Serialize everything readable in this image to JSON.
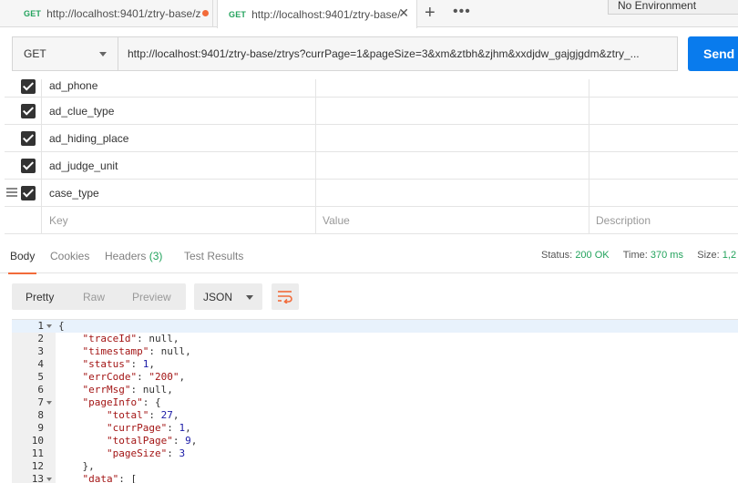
{
  "tabs": [
    {
      "method": "GET",
      "title": "http://localhost:9401/ztry-base/z",
      "unsaved": true
    },
    {
      "method": "GET",
      "title": "http://localhost:9401/ztry-base/",
      "close": "✕"
    }
  ],
  "tabbar": {
    "add": "+",
    "more": "•••",
    "environment": "No Environment"
  },
  "request": {
    "method": "GET",
    "url": "http://localhost:9401/ztry-base/ztrys?currPage=1&pageSize=3&xm&ztbh&zjhm&xxdjdw_gajgjgdm&ztry_...",
    "send_label": "Send"
  },
  "params": {
    "rows": [
      {
        "key": "ad_phone",
        "checked": true
      },
      {
        "key": "ad_clue_type",
        "checked": true
      },
      {
        "key": "ad_hiding_place",
        "checked": true
      },
      {
        "key": "ad_judge_unit",
        "checked": true
      },
      {
        "key": "case_type",
        "checked": true
      }
    ],
    "placeholder": {
      "key": "Key",
      "value": "Value",
      "description": "Description"
    }
  },
  "response": {
    "tabs": {
      "body": "Body",
      "cookies": "Cookies",
      "headers": "Headers",
      "headers_count": "(3)",
      "test_results": "Test Results"
    },
    "status_label": "Status:",
    "status_value": "200 OK",
    "time_label": "Time:",
    "time_value": "370 ms",
    "size_label": "Size:",
    "size_value": "1,2",
    "views": {
      "pretty": "Pretty",
      "raw": "Raw",
      "preview": "Preview"
    },
    "format": "JSON",
    "code_lines": [
      {
        "n": "1",
        "fold": true,
        "html": "{"
      },
      {
        "n": "2",
        "html": "    <span class=\"k\">\"traceId\"</span>: null,"
      },
      {
        "n": "3",
        "html": "    <span class=\"k\">\"timestamp\"</span>: null,"
      },
      {
        "n": "4",
        "html": "    <span class=\"k\">\"status\"</span>: <span class=\"n\">1</span>,"
      },
      {
        "n": "5",
        "html": "    <span class=\"k\">\"errCode\"</span>: <span class=\"s\">\"200\"</span>,"
      },
      {
        "n": "6",
        "html": "    <span class=\"k\">\"errMsg\"</span>: null,"
      },
      {
        "n": "7",
        "fold": true,
        "html": "    <span class=\"k\">\"pageInfo\"</span>: {"
      },
      {
        "n": "8",
        "html": "        <span class=\"k\">\"total\"</span>: <span class=\"n\">27</span>,"
      },
      {
        "n": "9",
        "html": "        <span class=\"k\">\"currPage\"</span>: <span class=\"n\">1</span>,"
      },
      {
        "n": "10",
        "html": "        <span class=\"k\">\"totalPage\"</span>: <span class=\"n\">9</span>,"
      },
      {
        "n": "11",
        "html": "        <span class=\"k\">\"pageSize\"</span>: <span class=\"n\">3</span>"
      },
      {
        "n": "12",
        "html": "    },"
      },
      {
        "n": "13",
        "fold": true,
        "html": "    <span class=\"k\">\"data\"</span>: ["
      }
    ]
  },
  "colors": {
    "accent": "#097bed",
    "ok": "#23a35d",
    "tab_indicator": "#f26b3a"
  }
}
